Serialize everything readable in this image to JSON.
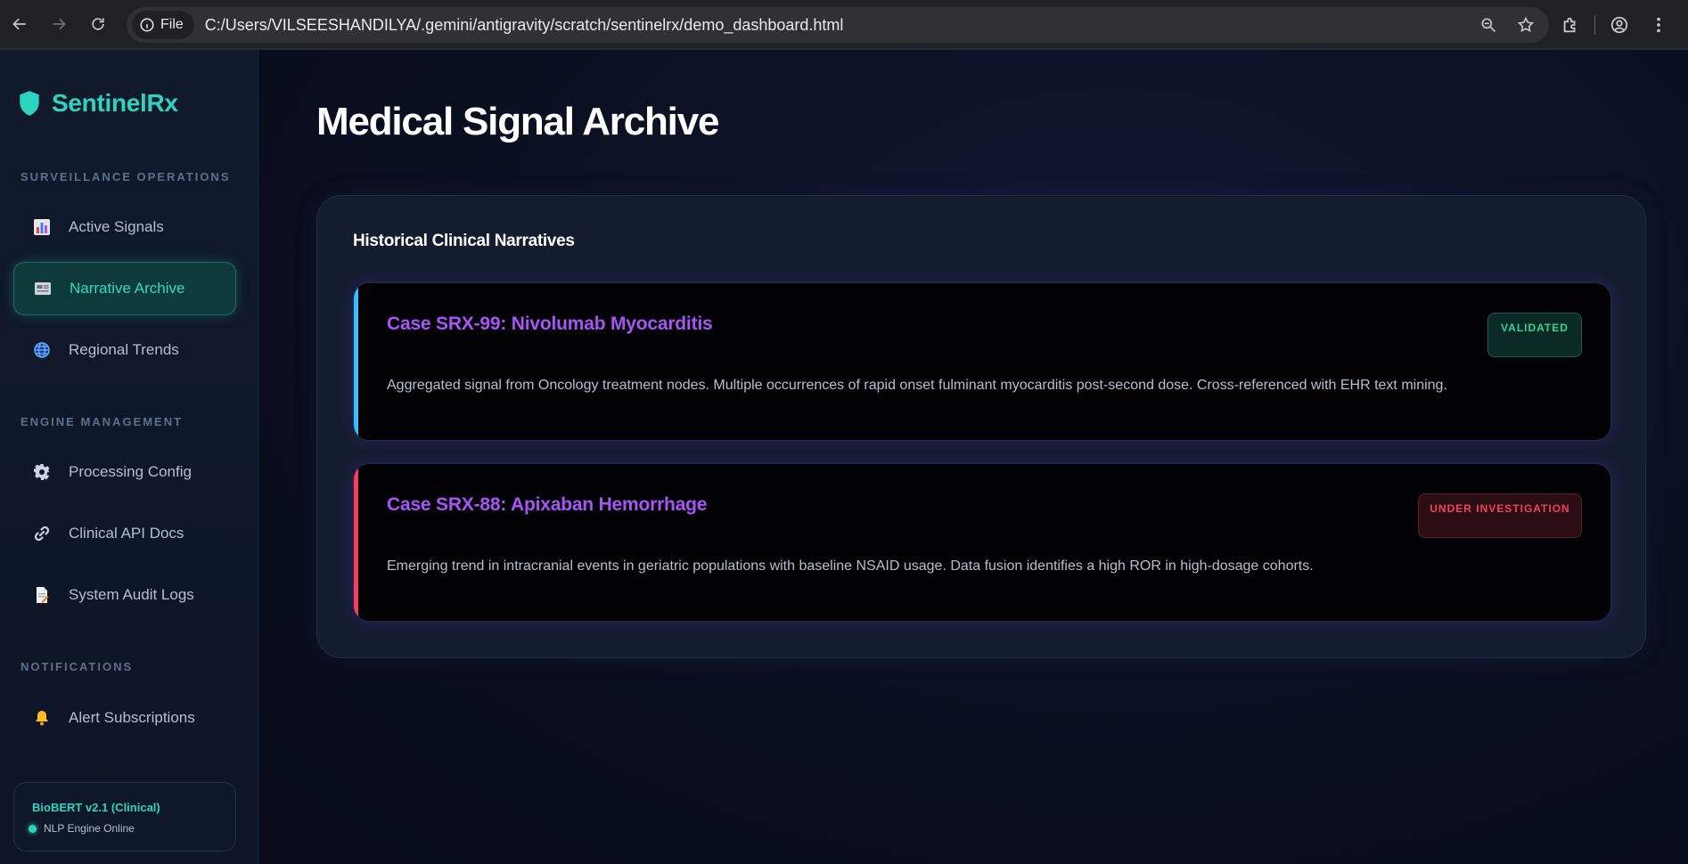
{
  "browser": {
    "site_chip": "File",
    "url": "C:/Users/VILSEESHANDILYA/.gemini/antigravity/scratch/sentinelrx/demo_dashboard.html"
  },
  "sidebar": {
    "brand": "SentinelRx",
    "sections": [
      {
        "label": "SURVEILLANCE OPERATIONS",
        "items": [
          {
            "label": "Active Signals",
            "icon": "bar-chart-icon"
          },
          {
            "label": "Narrative Archive",
            "icon": "newspaper-icon",
            "active": true
          },
          {
            "label": "Regional Trends",
            "icon": "globe-icon"
          }
        ]
      },
      {
        "label": "ENGINE MANAGEMENT",
        "items": [
          {
            "label": "Processing Config",
            "icon": "gear-icon"
          },
          {
            "label": "Clinical API Docs",
            "icon": "link-icon"
          },
          {
            "label": "System Audit Logs",
            "icon": "document-icon"
          }
        ]
      },
      {
        "label": "NOTIFICATIONS",
        "items": [
          {
            "label": "Alert Subscriptions",
            "icon": "bell-icon"
          }
        ]
      }
    ],
    "engine": {
      "title": "BioBERT v2.1 (Clinical)",
      "status": "NLP Engine Online"
    }
  },
  "main": {
    "title": "Medical Signal Archive",
    "panel_title": "Historical Clinical Narratives",
    "cases": [
      {
        "title": "Case SRX-99: Nivolumab Myocarditis",
        "description": "Aggregated signal from Oncology treatment nodes. Multiple occurrences of rapid onset fulminant myocarditis post-second dose. Cross-referenced with EHR text mining.",
        "status": "VALIDATED",
        "accent_color": "#38bdf8"
      },
      {
        "title": "Case SRX-88: Apixaban Hemorrhage",
        "description": "Emerging trend in intracranial events in geriatric populations with baseline NSAID usage. Data fusion identifies a high ROR in high-dosage cohorts.",
        "status": "UNDER INVESTIGATION",
        "accent_color": "#f43f5e"
      }
    ]
  },
  "colors": {
    "brand": "#2dd4bf",
    "case_title": "#a855f7",
    "validated": "#34d399",
    "investigating": "#f43f5e"
  }
}
